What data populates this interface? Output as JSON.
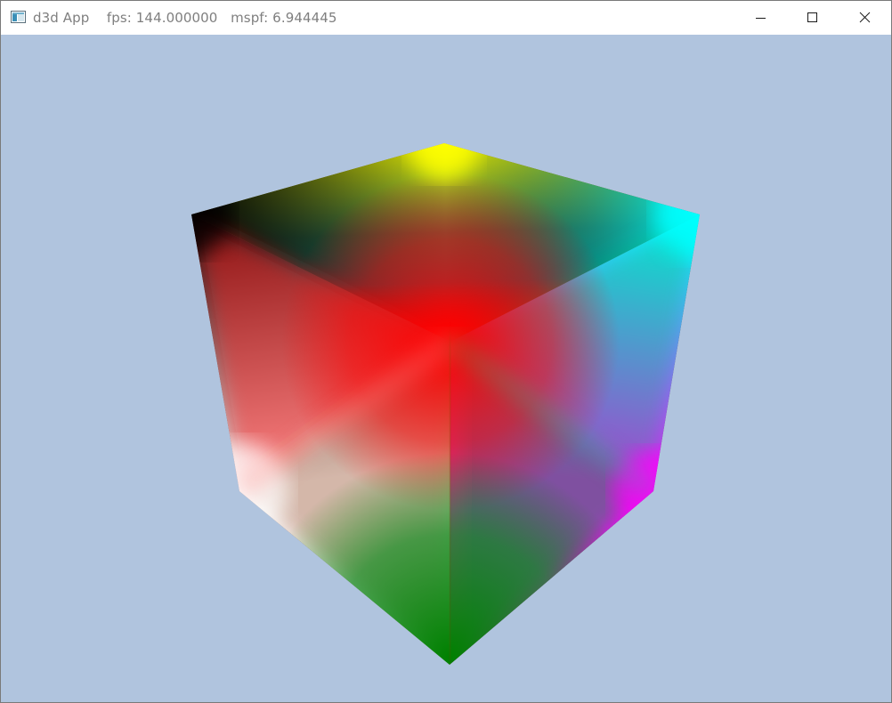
{
  "window": {
    "app_name": "d3d App",
    "fps_text": "fps: 144.000000",
    "mspf_text": "mspf: 6.944445"
  },
  "icons": {
    "app": "app-window-icon",
    "minimize": "minimize-icon",
    "maximize": "maximize-icon",
    "close": "close-icon"
  },
  "scene": {
    "clear_color": "#b0c4de",
    "cube_corner_colors": {
      "front_bottom": "#008000",
      "top_back": "#ffff00",
      "left_top": "#000000",
      "right_top": "#00ffff",
      "left_bottom": "#ffffff",
      "right_bottom": "#ff00ff",
      "center": "#ff0000"
    }
  }
}
